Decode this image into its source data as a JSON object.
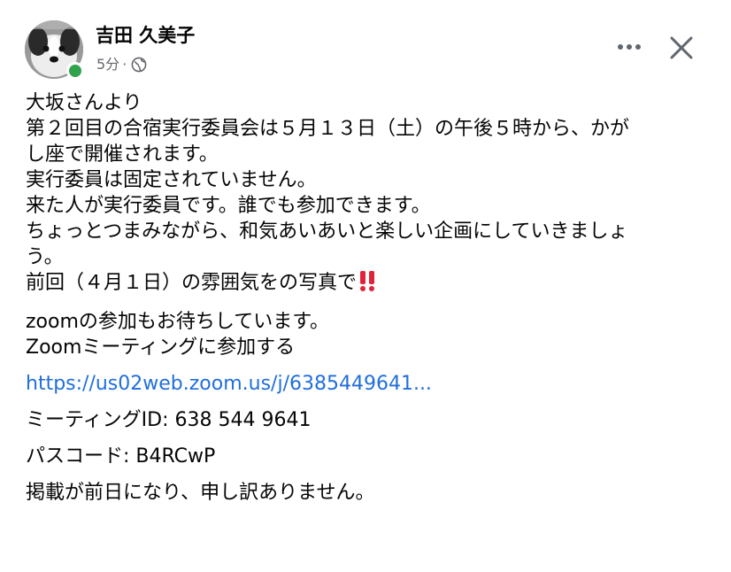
{
  "post": {
    "author": "吉田 久美子",
    "time": "5分",
    "separator": "·",
    "privacy_icon": "globe-icon",
    "online_color": "#31a24c",
    "link_color": "#216fdb",
    "lines": [
      "大坂さんより",
      "第２回目の合宿実行委員会は５月１３日（土）の午後５時から、かが",
      "し座で開催されます。",
      "実行委員は固定されていません。",
      "来た人が実行委員です。誰でも参加できます。",
      "ちょっとつまみながら、和気あいあいと楽しい企画にしていきましょ",
      "う。",
      "前回（４月１日）の雰囲気をの写真で"
    ],
    "emoji_name": "double-exclamation-icon",
    "zoom_lines": [
      "zoomの参加もお待ちしています。",
      "Zoomミーティングに参加する"
    ],
    "zoom_link": "https://us02web.zoom.us/j/6385449641...",
    "meeting_id": "ミーティングID: 638 544 9641",
    "passcode": "パスコード: B4RCwP",
    "closing": "掲載が前日になり、申し訳ありません。"
  }
}
